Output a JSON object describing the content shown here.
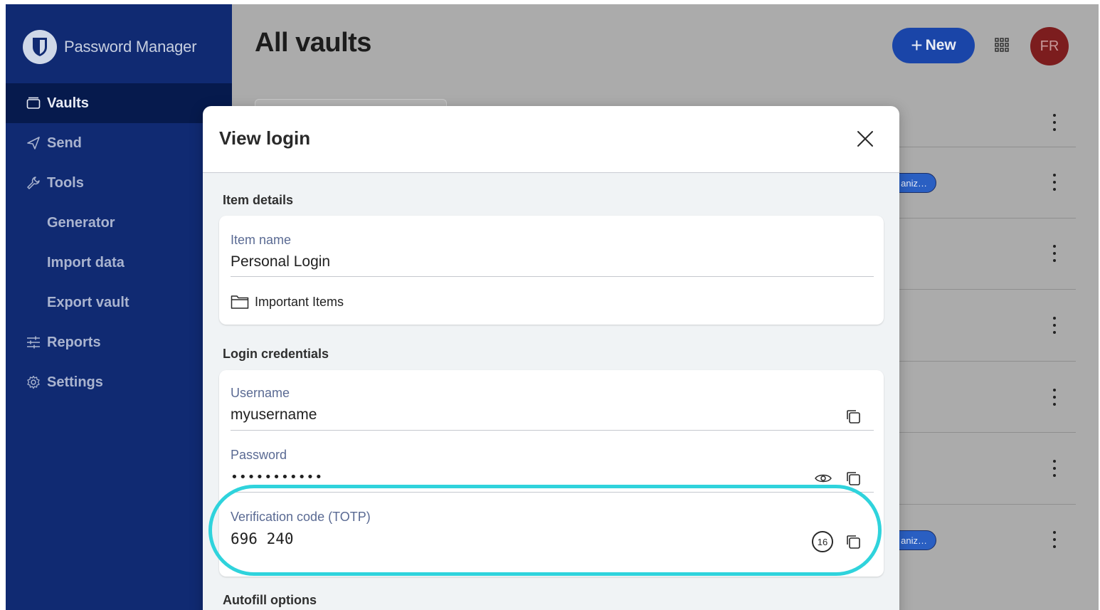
{
  "app": {
    "brand_name": "Password Manager"
  },
  "sidebar": {
    "items": [
      {
        "label": "Vaults",
        "icon": "vault-icon",
        "active": true
      },
      {
        "label": "Send",
        "icon": "send-icon"
      },
      {
        "label": "Tools",
        "icon": "wrench-icon"
      },
      {
        "label": "Generator",
        "sub": true
      },
      {
        "label": "Import data",
        "sub": true
      },
      {
        "label": "Export vault",
        "sub": true
      },
      {
        "label": "Reports",
        "icon": "sliders-icon"
      },
      {
        "label": "Settings",
        "icon": "gear-icon"
      }
    ]
  },
  "header": {
    "title": "All vaults",
    "new_button_label": "New",
    "avatar_initials": "FR"
  },
  "vault_list": {
    "org_badge_label": "aniz…"
  },
  "dialog": {
    "title": "View login",
    "item_details": {
      "section_title": "Item details",
      "item_name_label": "Item name",
      "item_name_value": "Personal Login",
      "folder": "Important Items"
    },
    "login_credentials": {
      "section_title": "Login credentials",
      "username_label": "Username",
      "username_value": "myusername",
      "password_label": "Password",
      "password_value": "•••••••••••",
      "totp_label": "Verification code (TOTP)",
      "totp_value": "696 240",
      "totp_seconds_remaining": "16"
    },
    "autofill": {
      "section_title": "Autofill options"
    }
  },
  "colors": {
    "sidebar_bg": "#102a72",
    "accent": "#1a45a8",
    "highlight": "#2fd3dc",
    "avatar": "#7c1d1e"
  }
}
